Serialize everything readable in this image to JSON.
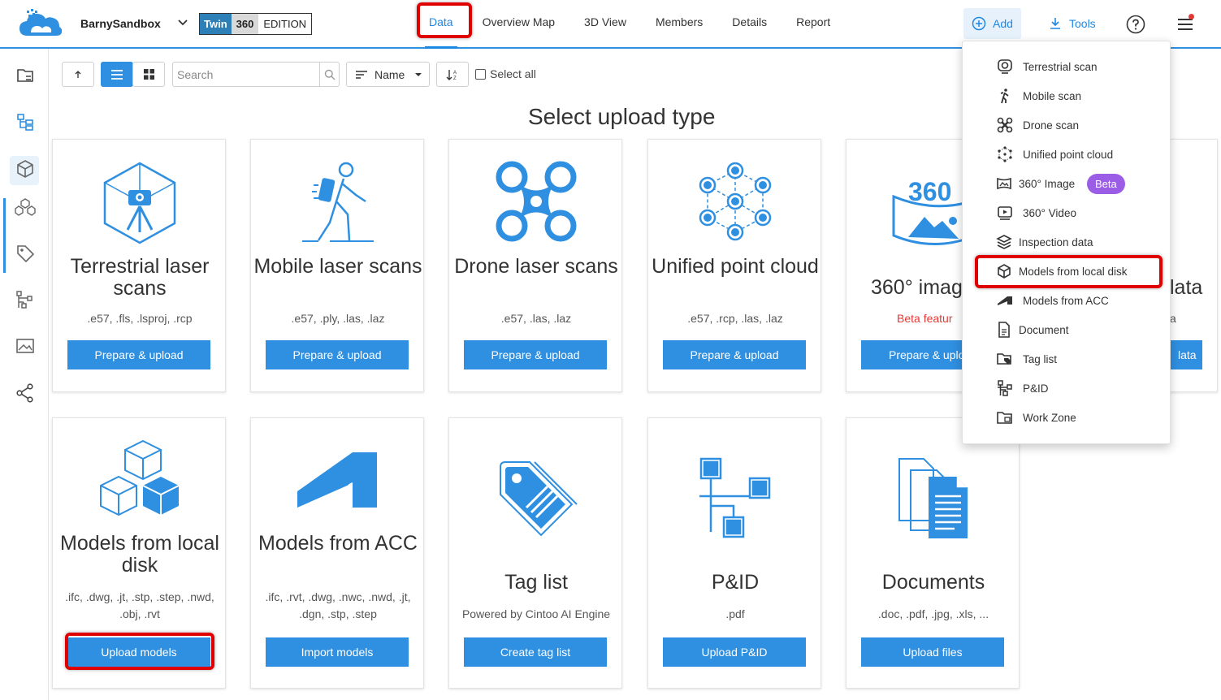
{
  "app": {
    "project_name": "BarnySandbox"
  },
  "edition": {
    "twin": "Twin",
    "three60": "360",
    "label": "EDITION"
  },
  "nav": {
    "items": [
      "Data",
      "Overview Map",
      "3D View",
      "Members",
      "Details",
      "Report"
    ],
    "active": "Data"
  },
  "topbar": {
    "add_label": "Add",
    "tools_label": "Tools"
  },
  "toolbar": {
    "search_placeholder": "Search",
    "sort_label": "Name",
    "select_all_label": "Select all"
  },
  "page": {
    "title": "Select upload type"
  },
  "cards": [
    {
      "title": "Terrestrial laser scans",
      "desc": ".e57, .fls, .lsproj, .rcp",
      "button": "Prepare & upload"
    },
    {
      "title": "Mobile laser scans",
      "desc": ".e57, .ply, .las, .laz",
      "button": "Prepare & upload"
    },
    {
      "title": "Drone laser scans",
      "desc": ".e57, .las, .laz",
      "button": "Prepare & upload"
    },
    {
      "title": "Unified point cloud",
      "desc": ".e57, .rcp, .las, .laz",
      "button": "Prepare & upload"
    },
    {
      "title": "360° imag",
      "desc": "Beta featur",
      "button": "Prepare & uplo"
    },
    {
      "title": "lata",
      "desc": "a",
      "button": "lata"
    },
    {
      "title": "Models from local disk",
      "desc": ".ifc, .dwg, .jt, .stp, .step, .nwd, .obj, .rvt",
      "button": "Upload models"
    },
    {
      "title": "Models from ACC",
      "desc": ".ifc, .rvt, .dwg, .nwc, .nwd, .jt, .dgn, .stp, .step",
      "button": "Import models"
    },
    {
      "title": "Tag list",
      "desc": "Powered by Cintoo AI Engine",
      "button": "Create tag list"
    },
    {
      "title": "P&ID",
      "desc": ".pdf",
      "button": "Upload P&ID"
    },
    {
      "title": "Documents",
      "desc": ".doc, .pdf, .jpg, .xls, ...",
      "button": "Upload files"
    }
  ],
  "dropdown": {
    "items": [
      {
        "label": "Terrestrial scan",
        "icon": "terrestrial-scan-icon"
      },
      {
        "label": "Mobile scan",
        "icon": "walking-person-icon"
      },
      {
        "label": "Drone scan",
        "icon": "drone-icon"
      },
      {
        "label": "Unified point cloud",
        "icon": "point-cloud-icon"
      },
      {
        "label": "360° Image",
        "icon": "panorama-icon",
        "badge": "Beta"
      },
      {
        "label": "360° Video",
        "icon": "video-icon"
      },
      {
        "label": "Inspection data",
        "icon": "layers-icon"
      },
      {
        "label": "Models from local disk",
        "icon": "cube-icon"
      },
      {
        "label": "Models from ACC",
        "icon": "acc-logo-icon"
      },
      {
        "label": "Document",
        "icon": "document-icon"
      },
      {
        "label": "Tag list",
        "icon": "tag-folder-icon"
      },
      {
        "label": "P&ID",
        "icon": "diagram-icon"
      },
      {
        "label": "Work Zone",
        "icon": "work-zone-icon"
      }
    ]
  },
  "colors": {
    "accent": "#2f8fe0",
    "highlight": "#e00000",
    "beta": "#9b5de5",
    "beta_text": "#e53935"
  }
}
